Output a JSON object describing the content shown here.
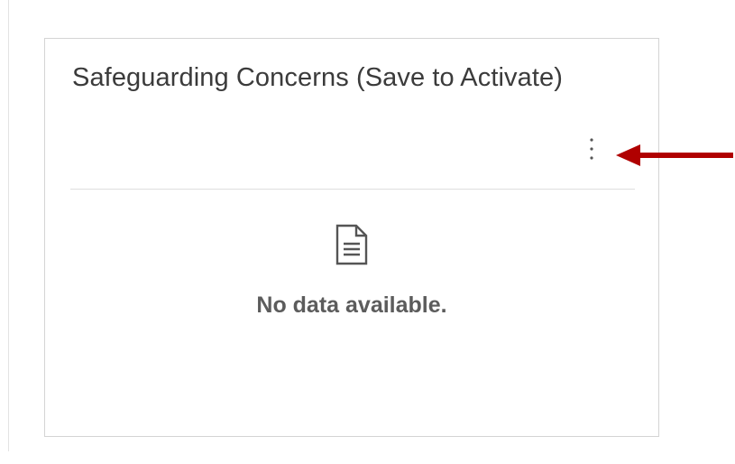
{
  "card": {
    "title": "Safeguarding Concerns (Save to Activate)",
    "more_options_icon": "vertical-ellipsis",
    "empty_state": {
      "icon": "document-icon",
      "message": "No data available."
    }
  },
  "annotation": {
    "type": "arrow",
    "color": "#b00000",
    "points_to": "more-options-button"
  }
}
